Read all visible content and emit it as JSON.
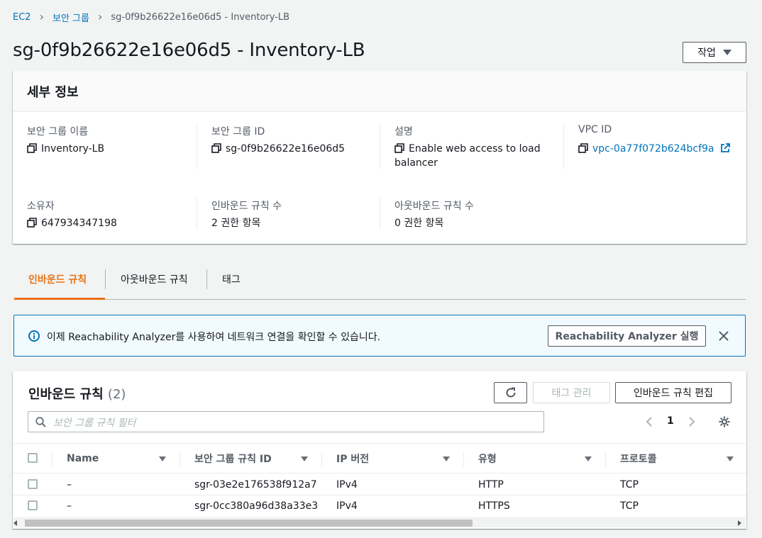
{
  "breadcrumb": {
    "ec2": "EC2",
    "groups": "보안 그룹",
    "current": "sg-0f9b26622e16e06d5 - Inventory-LB"
  },
  "page_title": "sg-0f9b26622e16e06d5 - Inventory-LB",
  "actions_button": "작업",
  "details": {
    "title": "세부 정보",
    "name_label": "보안 그룹 이름",
    "name_value": "Inventory-LB",
    "id_label": "보안 그룹 ID",
    "id_value": "sg-0f9b26622e16e06d5",
    "desc_label": "설명",
    "desc_value_line1": "Enable web access to load",
    "desc_value_line2": "balancer",
    "vpc_label": "VPC ID",
    "vpc_value": "vpc-0a77f072b624bcf9a",
    "owner_label": "소유자",
    "owner_value": "647934347198",
    "inbound_count_label": "인바운드 규칙 수",
    "inbound_count_value": "2 권한 항목",
    "outbound_count_label": "아웃바운드 규칙 수",
    "outbound_count_value": "0 권한 항목"
  },
  "tabs": [
    {
      "label": "인바운드 규칙",
      "active": true
    },
    {
      "label": "아웃바운드 규칙",
      "active": false
    },
    {
      "label": "태그",
      "active": false
    }
  ],
  "banner": {
    "text": "이제 Reachability Analyzer를 사용하여 네트워크 연결을 확인할 수 있습니다.",
    "button": "Reachability Analyzer 실행"
  },
  "rules": {
    "title": "인바운드 규칙",
    "count": "(2)",
    "manage_tags": "태그 관리",
    "edit_button": "인바운드 규칙 편집",
    "filter_placeholder": "보안 그룹 규칙 필터",
    "page": "1",
    "columns": [
      "Name",
      "보안 그룹 규칙 ID",
      "IP 버전",
      "유형",
      "프로토콜"
    ],
    "rows": [
      {
        "name": "–",
        "rule_id": "sgr-03e2e176538f912a7",
        "ip_version": "IPv4",
        "type": "HTTP",
        "protocol": "TCP"
      },
      {
        "name": "–",
        "rule_id": "sgr-0cc380a96d38a33e3",
        "ip_version": "IPv4",
        "type": "HTTPS",
        "protocol": "TCP"
      }
    ]
  },
  "colors": {
    "link": "#0073bb",
    "accent": "#ec7211",
    "info_bg": "#f1faff"
  }
}
